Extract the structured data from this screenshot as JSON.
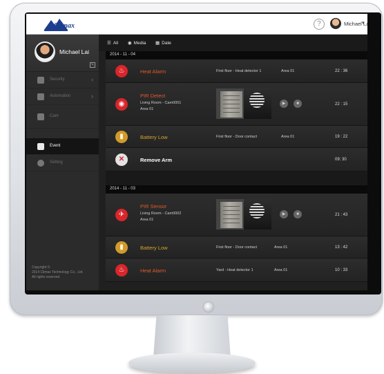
{
  "topbar": {
    "logo_text": "Climax",
    "help_icon": "?",
    "user_name": "Michael Lai",
    "caret": "▾"
  },
  "sidebar": {
    "profile_name": "Michael Lai",
    "edit_icon": "✎",
    "items": [
      {
        "label": "Security",
        "icon": "shield-icon",
        "chevron": "›"
      },
      {
        "label": "Automation",
        "icon": "automation-icon",
        "chevron": "›"
      },
      {
        "label": "Cam",
        "icon": "camera-icon",
        "chevron": ""
      },
      {
        "label": "Event",
        "icon": "event-icon",
        "chevron": ""
      },
      {
        "label": "Setting",
        "icon": "gear-icon",
        "chevron": ""
      }
    ],
    "copyright_lines": [
      "Copyright ©",
      "2014 Climax Technology Co., Ltd.",
      "All rights reserved."
    ]
  },
  "filters": {
    "all": "All",
    "media": "Media",
    "date": "Date"
  },
  "days": [
    {
      "date": "2014 - 11 - 04",
      "events": [
        {
          "title": "Heat Alarm",
          "sub1": "",
          "sub2": "",
          "device": "First floor - Heat detector 1",
          "area": "Area 01",
          "time": "22 : 36",
          "icon": "fire-icon",
          "glyph": "♨"
        },
        {
          "title": "PIR Detect",
          "sub1": "Living Room - Cam0001",
          "sub2": "Area 01",
          "device": "",
          "area": "",
          "time": "22 : 15",
          "icon": "camera-alert-icon",
          "glyph": "◉"
        },
        {
          "title": "Battery Low",
          "sub1": "",
          "sub2": "",
          "device": "First floor - Door contact",
          "area": "Area 01",
          "time": "19 : 22",
          "icon": "door-contact-icon",
          "glyph": "▮"
        },
        {
          "title": "Remove Arm",
          "sub1": "",
          "sub2": "",
          "device": "",
          "area": "",
          "time": "09: 30",
          "icon": "close-icon",
          "glyph": "✕"
        }
      ]
    },
    {
      "date": "2014 - 11 - 03",
      "events": [
        {
          "title": "PIR Sensor",
          "sub1": "Living Room - Cam0002",
          "sub2": "Area 01",
          "device": "",
          "area": "",
          "time": "21 : 43",
          "icon": "running-man-icon",
          "glyph": "✈"
        },
        {
          "title": "Battery Low",
          "sub1": "",
          "sub2": "",
          "device": "First floor - Door contact",
          "area": "Area 01",
          "time": "13 : 42",
          "icon": "door-contact-icon",
          "glyph": "▮"
        },
        {
          "title": "Heat Alarm",
          "sub1": "",
          "sub2": "",
          "device": "Yard - Heat detector 1",
          "area": "Area 01",
          "time": "10 : 33",
          "icon": "fire-icon",
          "glyph": "♨"
        }
      ]
    }
  ],
  "media_controls": {
    "play": "▶",
    "stop": "■"
  }
}
